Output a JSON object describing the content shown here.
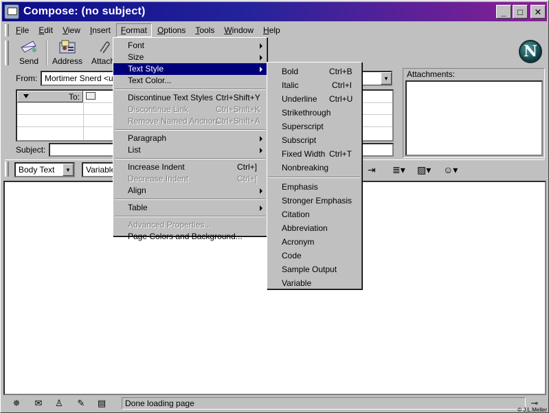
{
  "window": {
    "title": "Compose: (no subject)",
    "minimize": "_",
    "maximize": "□",
    "close": "✕"
  },
  "menubar": [
    {
      "label": "File",
      "ul": "F",
      "rest": "ile"
    },
    {
      "label": "Edit",
      "ul": "E",
      "rest": "dit"
    },
    {
      "label": "View",
      "ul": "V",
      "rest": "iew"
    },
    {
      "label": "Insert",
      "ul": "I",
      "rest": "nsert"
    },
    {
      "label": "Format",
      "ul": "F",
      "rest": "ormat"
    },
    {
      "label": "Options",
      "ul": "O",
      "rest": "ptions"
    },
    {
      "label": "Tools",
      "ul": "T",
      "rest": "ools"
    },
    {
      "label": "Window",
      "ul": "W",
      "rest": "indow"
    },
    {
      "label": "Help",
      "ul": "H",
      "rest": "elp"
    }
  ],
  "toolbar": {
    "send": "Send",
    "address": "Address",
    "attach": "Attach"
  },
  "header": {
    "from_label": "From:",
    "from_value": "Mortimer Snerd <use",
    "to_label": "To:",
    "subject_label": "Subject:",
    "attachments_label": "Attachments:"
  },
  "format_toolbar": {
    "paragraph_style": "Body Text",
    "font": "Variable"
  },
  "format_menu": {
    "font": "Font",
    "size": "Size",
    "text_style": "Text Style",
    "text_color": "Text Color...",
    "discontinue_text_styles": "Discontinue Text Styles",
    "discontinue_text_styles_sc": "Ctrl+Shift+Y",
    "discontinue_link": "Discontinue Link",
    "discontinue_link_sc": "Ctrl+Shift+K",
    "remove_named_anchors": "Remove Named Anchors",
    "remove_named_anchors_sc": "Ctrl+Shift+A",
    "paragraph": "Paragraph",
    "list": "List",
    "increase_indent": "Increase Indent",
    "increase_indent_sc": "Ctrl+]",
    "decrease_indent": "Decrease Indent",
    "decrease_indent_sc": "Ctrl+[",
    "align": "Align",
    "table": "Table",
    "advanced_properties": "Advanced Properties...",
    "page_colors": "Page Colors and Background..."
  },
  "text_style_menu": {
    "bold": "Bold",
    "bold_sc": "Ctrl+B",
    "italic": "Italic",
    "italic_sc": "Ctrl+I",
    "underline": "Underline",
    "underline_sc": "Ctrl+U",
    "strikethrough": "Strikethrough",
    "superscript": "Superscript",
    "subscript": "Subscript",
    "fixed_width": "Fixed Width",
    "fixed_width_sc": "Ctrl+T",
    "nonbreaking": "Nonbreaking",
    "emphasis": "Emphasis",
    "stronger_emphasis": "Stronger Emphasis",
    "citation": "Citation",
    "abbreviation": "Abbreviation",
    "acronym": "Acronym",
    "code": "Code",
    "sample_output": "Sample Output",
    "variable": "Variable"
  },
  "status": {
    "text": "Done loading page",
    "credit": "© J.L.Meller"
  }
}
